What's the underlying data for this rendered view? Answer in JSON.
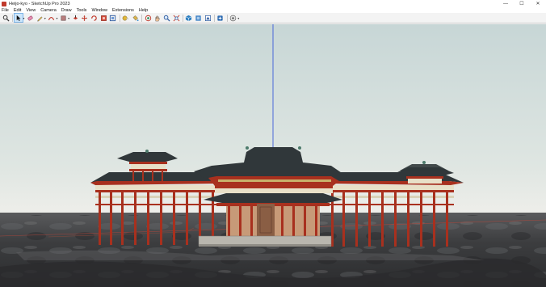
{
  "window": {
    "title": "Heijo-kyo - SketchUp Pro 2023",
    "minimize_glyph": "—",
    "maximize_glyph": "☐",
    "close_glyph": "✕"
  },
  "menu": [
    "File",
    "Edit",
    "View",
    "Camera",
    "Draw",
    "Tools",
    "Window",
    "Extensions",
    "Help"
  ],
  "toolbar": {
    "tools": [
      "zoom-icon",
      "select-icon",
      "eraser-icon",
      "pencil-icon",
      "arc-icon",
      "shape-icon",
      "push-pull-icon",
      "move-icon",
      "rotate-icon",
      "scale-icon",
      "offset-icon",
      "tape-measure-icon",
      "paint-bucket-icon",
      "orbit-icon",
      "pan-icon",
      "zoom-window-icon",
      "zoom-extents-icon",
      "3d-warehouse-icon",
      "extension-warehouse-icon",
      "layout-icon",
      "extension-manager-icon",
      "section-icon",
      "settings-icon"
    ]
  },
  "colors": {
    "sky_top": "#c8d6d6",
    "sky_horizon": "#e6ebe6",
    "ground": "#4a4a4a",
    "column_red": "#a8301e",
    "roof_dark": "#33383a",
    "axis_blue": "#3b5bd9"
  }
}
